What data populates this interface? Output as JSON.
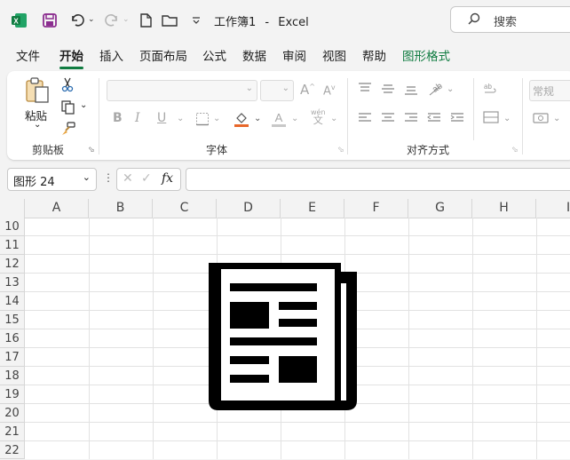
{
  "app": {
    "title": "工作簿1",
    "separator": "-",
    "app_name": "Excel"
  },
  "search": {
    "placeholder": "搜索"
  },
  "menu": [
    "文件",
    "开始",
    "插入",
    "页面布局",
    "公式",
    "数据",
    "审阅",
    "视图",
    "帮助",
    "图形格式"
  ],
  "menu_active_index": 1,
  "ribbon": {
    "clipboard": {
      "paste_label": "粘贴",
      "group_label": "剪贴板"
    },
    "font": {
      "group_label": "字体",
      "phonetic_top": "wén",
      "phonetic_bottom": "文"
    },
    "alignment": {
      "group_label": "对齐方式"
    },
    "number": {
      "format_value": "常规"
    }
  },
  "formula_bar": {
    "name_box": "图形 24",
    "fx": "fx",
    "formula": ""
  },
  "columns": [
    "A",
    "B",
    "C",
    "D",
    "E",
    "F",
    "G",
    "H",
    "I"
  ],
  "rows": [
    "10",
    "11",
    "12",
    "13",
    "14",
    "15",
    "16",
    "17",
    "18",
    "19",
    "20",
    "21",
    "22"
  ],
  "colors": {
    "accent": "#107c41",
    "excel_green": "#107c41",
    "save_purple": "#8b2d8f"
  },
  "shape": {
    "name": "newspaper-icon"
  }
}
